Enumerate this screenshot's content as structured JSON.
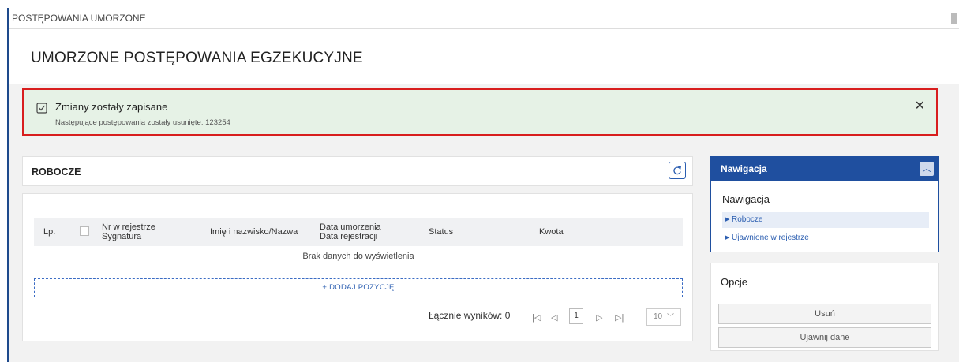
{
  "window": {
    "breadcrumb": "POSTĘPOWANIA UMORZONE"
  },
  "page": {
    "title": "UMORZONE POSTĘPOWANIA EGZEKUCYJNE"
  },
  "alert": {
    "title": "Zmiany zostały zapisane",
    "message": "Następujące postępowania zostały usunięte: 123254",
    "close": "✕"
  },
  "panel": {
    "title": "ROBOCZE"
  },
  "table": {
    "columns": {
      "lp": "Lp.",
      "nr_line1": "Nr w rejestrze",
      "nr_line2": "Sygnatura",
      "name": "Imię i nazwisko/Nazwa",
      "date_line1": "Data umorzenia",
      "date_line2": "Data rejestracji",
      "status": "Status",
      "amount": "Kwota"
    },
    "empty_text": "Brak danych do wyświetlenia",
    "add_label": "+ DODAJ POZYCJĘ"
  },
  "pagination": {
    "total_label": "Łącznie wyników: 0",
    "current_page": "1",
    "per_page": "10"
  },
  "nav": {
    "header": "Nawigacja",
    "subtitle": "Nawigacja",
    "items": [
      "Robocze",
      "Ujawnione w rejestrze"
    ]
  },
  "options": {
    "title": "Opcje",
    "delete_label": "Usuń",
    "reveal_label": "Ujawnij dane"
  },
  "colors": {
    "primary": "#1f4f9f",
    "alert_bg": "#e6f2e6",
    "alert_border": "#d81e1e"
  }
}
